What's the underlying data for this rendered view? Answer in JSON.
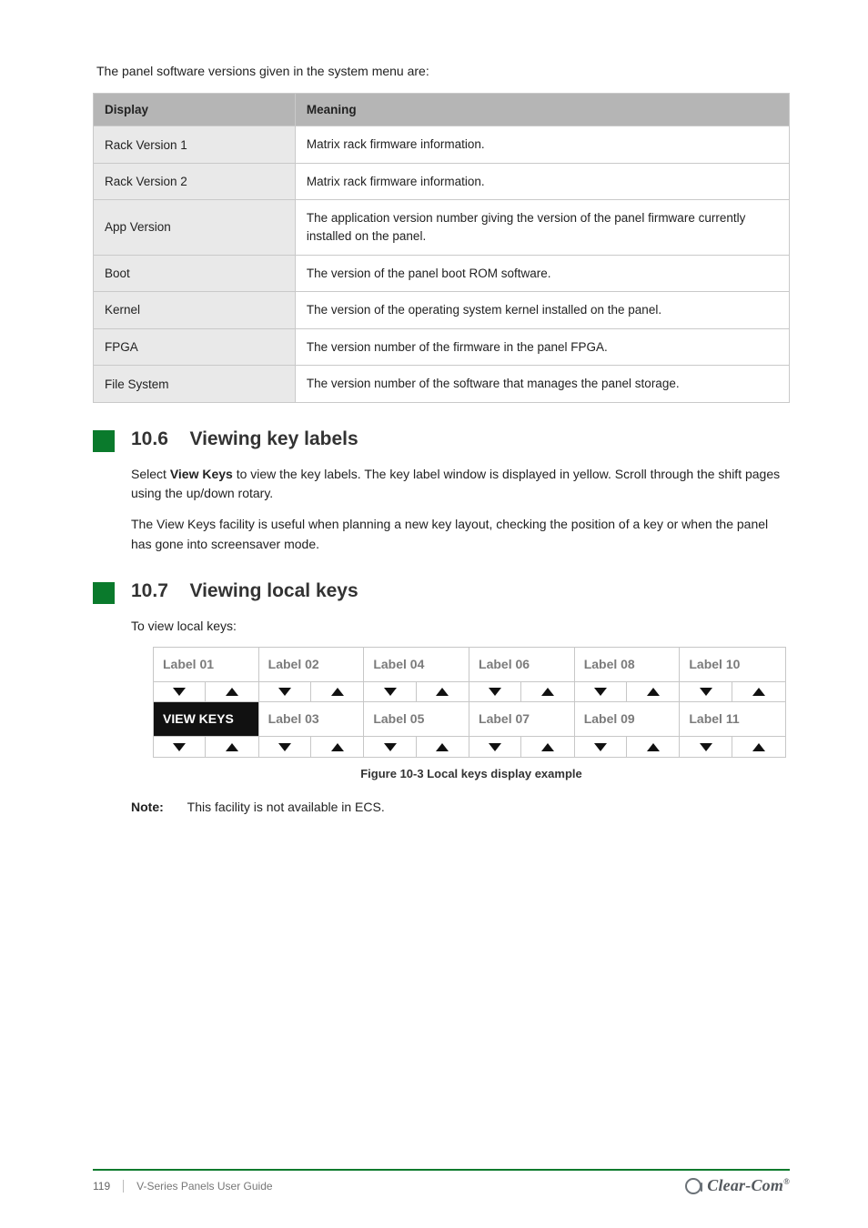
{
  "lead_text": "The panel software versions given in the system menu are:",
  "table": {
    "headers": [
      "Display",
      "Meaning"
    ],
    "rows": [
      [
        "Rack Version 1",
        "Matrix rack firmware information."
      ],
      [
        "Rack Version 2",
        "Matrix rack firmware information."
      ],
      [
        "App Version",
        "The application version number giving the version of the panel firmware currently installed on the panel."
      ],
      [
        "Boot",
        "The version of the panel boot ROM software."
      ],
      [
        "Kernel",
        "The version of the operating system kernel installed on the panel."
      ],
      [
        "FPGA",
        "The version number of the firmware in the panel FPGA."
      ],
      [
        "File System",
        "The version number of the software that manages the panel storage."
      ]
    ]
  },
  "section_keys": {
    "num": "10.6",
    "title": "Viewing key labels",
    "p1_a": "Select ",
    "p1_b": "View Keys",
    "p1_c": " to view the key labels. The key label window is displayed in yellow. Scroll through the shift pages using the up/down rotary.",
    "p2": "The View Keys facility is useful when planning a new key layout, checking the position of a key or when the panel has gone into screensaver mode."
  },
  "section_lk": {
    "num": "10.7",
    "title": "Viewing local keys",
    "intro": "To view local keys:",
    "fig_caption": "Figure 10-3 Local keys display example",
    "note_label": "Note:",
    "note_text": "This facility is not available in ECS."
  },
  "figure": {
    "top_labels": [
      "Label 01",
      "Label 02",
      "Label 04",
      "Label 06",
      "Label 08",
      "Label 10"
    ],
    "bottom_labels": [
      "VIEW KEYS",
      "Label 03",
      "Label 05",
      "Label 07",
      "Label 09",
      "Label 11"
    ]
  },
  "footer": {
    "page": "119",
    "doc": "V-Series Panels User Guide",
    "brand": "Clear-Com"
  }
}
